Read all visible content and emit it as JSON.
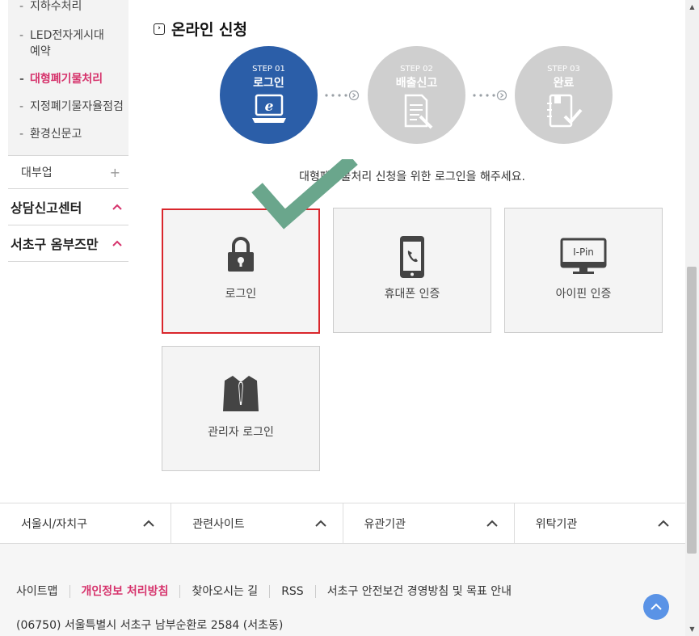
{
  "sidebar": {
    "sub_items": [
      {
        "label": "지하수처리",
        "active": false
      },
      {
        "label": "LED전자게시대 예약",
        "active": false
      },
      {
        "label": "대형폐기물처리",
        "active": true
      },
      {
        "label": "지정폐기물자율점검",
        "active": false
      },
      {
        "label": "환경신문고",
        "active": false
      }
    ],
    "minor_menu": {
      "label": "대부업",
      "icon": "+"
    },
    "major_menus": [
      {
        "label": "상담신고센터"
      },
      {
        "label": "서초구 옴부즈만"
      }
    ]
  },
  "main": {
    "title": "온라인 신청",
    "steps": [
      {
        "no": "STEP 01",
        "label": "로그인",
        "icon": "laptop-icon"
      },
      {
        "no": "STEP 02",
        "label": "배출신고",
        "icon": "document-icon"
      },
      {
        "no": "STEP 03",
        "label": "완료",
        "icon": "notebook-check-icon"
      }
    ],
    "guide": "대형폐기물처리 신청을 위한 로그인을 해주세요.",
    "login_options": [
      {
        "label": "로그인",
        "icon": "lock-icon",
        "selected": true
      },
      {
        "label": "휴대폰 인증",
        "icon": "mobile-phone-icon"
      },
      {
        "label": "아이핀 인증",
        "icon": "ipin-monitor-icon",
        "icon_text": "I-Pin"
      },
      {
        "label": "관리자 로그인",
        "icon": "admin-suit-icon"
      }
    ]
  },
  "footer": {
    "link_groups": [
      "서울시/자치구",
      "관련사이트",
      "유관기관",
      "위탁기관"
    ],
    "menu": [
      {
        "label": "사이트맵",
        "highlight": false
      },
      {
        "label": "개인정보 처리방침",
        "highlight": true
      },
      {
        "label": "찾아오시는 길",
        "highlight": false
      },
      {
        "label": "RSS",
        "highlight": false
      },
      {
        "label": "서초구 안전보건 경영방침 및 목표 안내",
        "highlight": false
      }
    ],
    "address": "(06750) 서울특별시 서초구 남부순환로 2584 (서초동)"
  },
  "colors": {
    "accent": "#d6336c",
    "step_active": "#2b5ea8",
    "step_inactive": "#cfcfcf",
    "check": "#6aa68c",
    "select_border": "#d9262c",
    "top_button": "#5a93e6"
  }
}
